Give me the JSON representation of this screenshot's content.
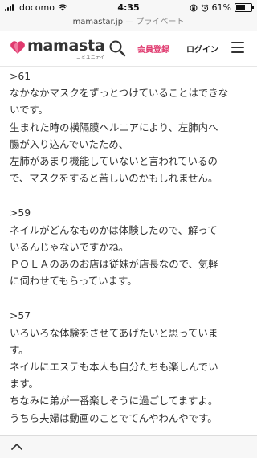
{
  "status_bar": {
    "carrier": "docomo",
    "time": "4:35",
    "battery": "61%",
    "battery_level": 0.61
  },
  "url_bar": {
    "domain": "mamastar.jp",
    "separator": "—",
    "mode": "プライベート"
  },
  "header": {
    "logo_word": "mamasta",
    "logo_sub": "コミュニティ",
    "register_label": "会員登録",
    "login_label": "ログイン",
    "brand_color": "#e03a6f"
  },
  "comments": [
    {
      "lines": [
        ">61",
        "なかなかマスクをずっとつけていることはできな",
        "いです。",
        "生まれた時の横隔膜ヘルニアにより、左肺内へ",
        "腸が入り込んでいたため、",
        "左肺があまり機能していないと言われているの",
        "で、マスクをすると苦しいのかもしれません。"
      ]
    },
    {
      "lines": [
        ">59",
        "ネイルがどんなものかは体験したので、解って",
        "いるんじゃないですかね。",
        "ＰＯＬＡのあのお店は従妹が店長なので、気軽",
        "に伺わせてもらっています。"
      ]
    },
    {
      "lines": [
        ">57",
        "いろいろな体験をさせてあげたいと思っていま",
        "す。",
        "ネイルにエステも本人も自分たちも楽しんでい",
        "ます。",
        "ちなみに弟が一番楽しそうに過ごしてますよ。",
        "うちら夫婦は動画のことでてんやわんやです。"
      ]
    }
  ]
}
